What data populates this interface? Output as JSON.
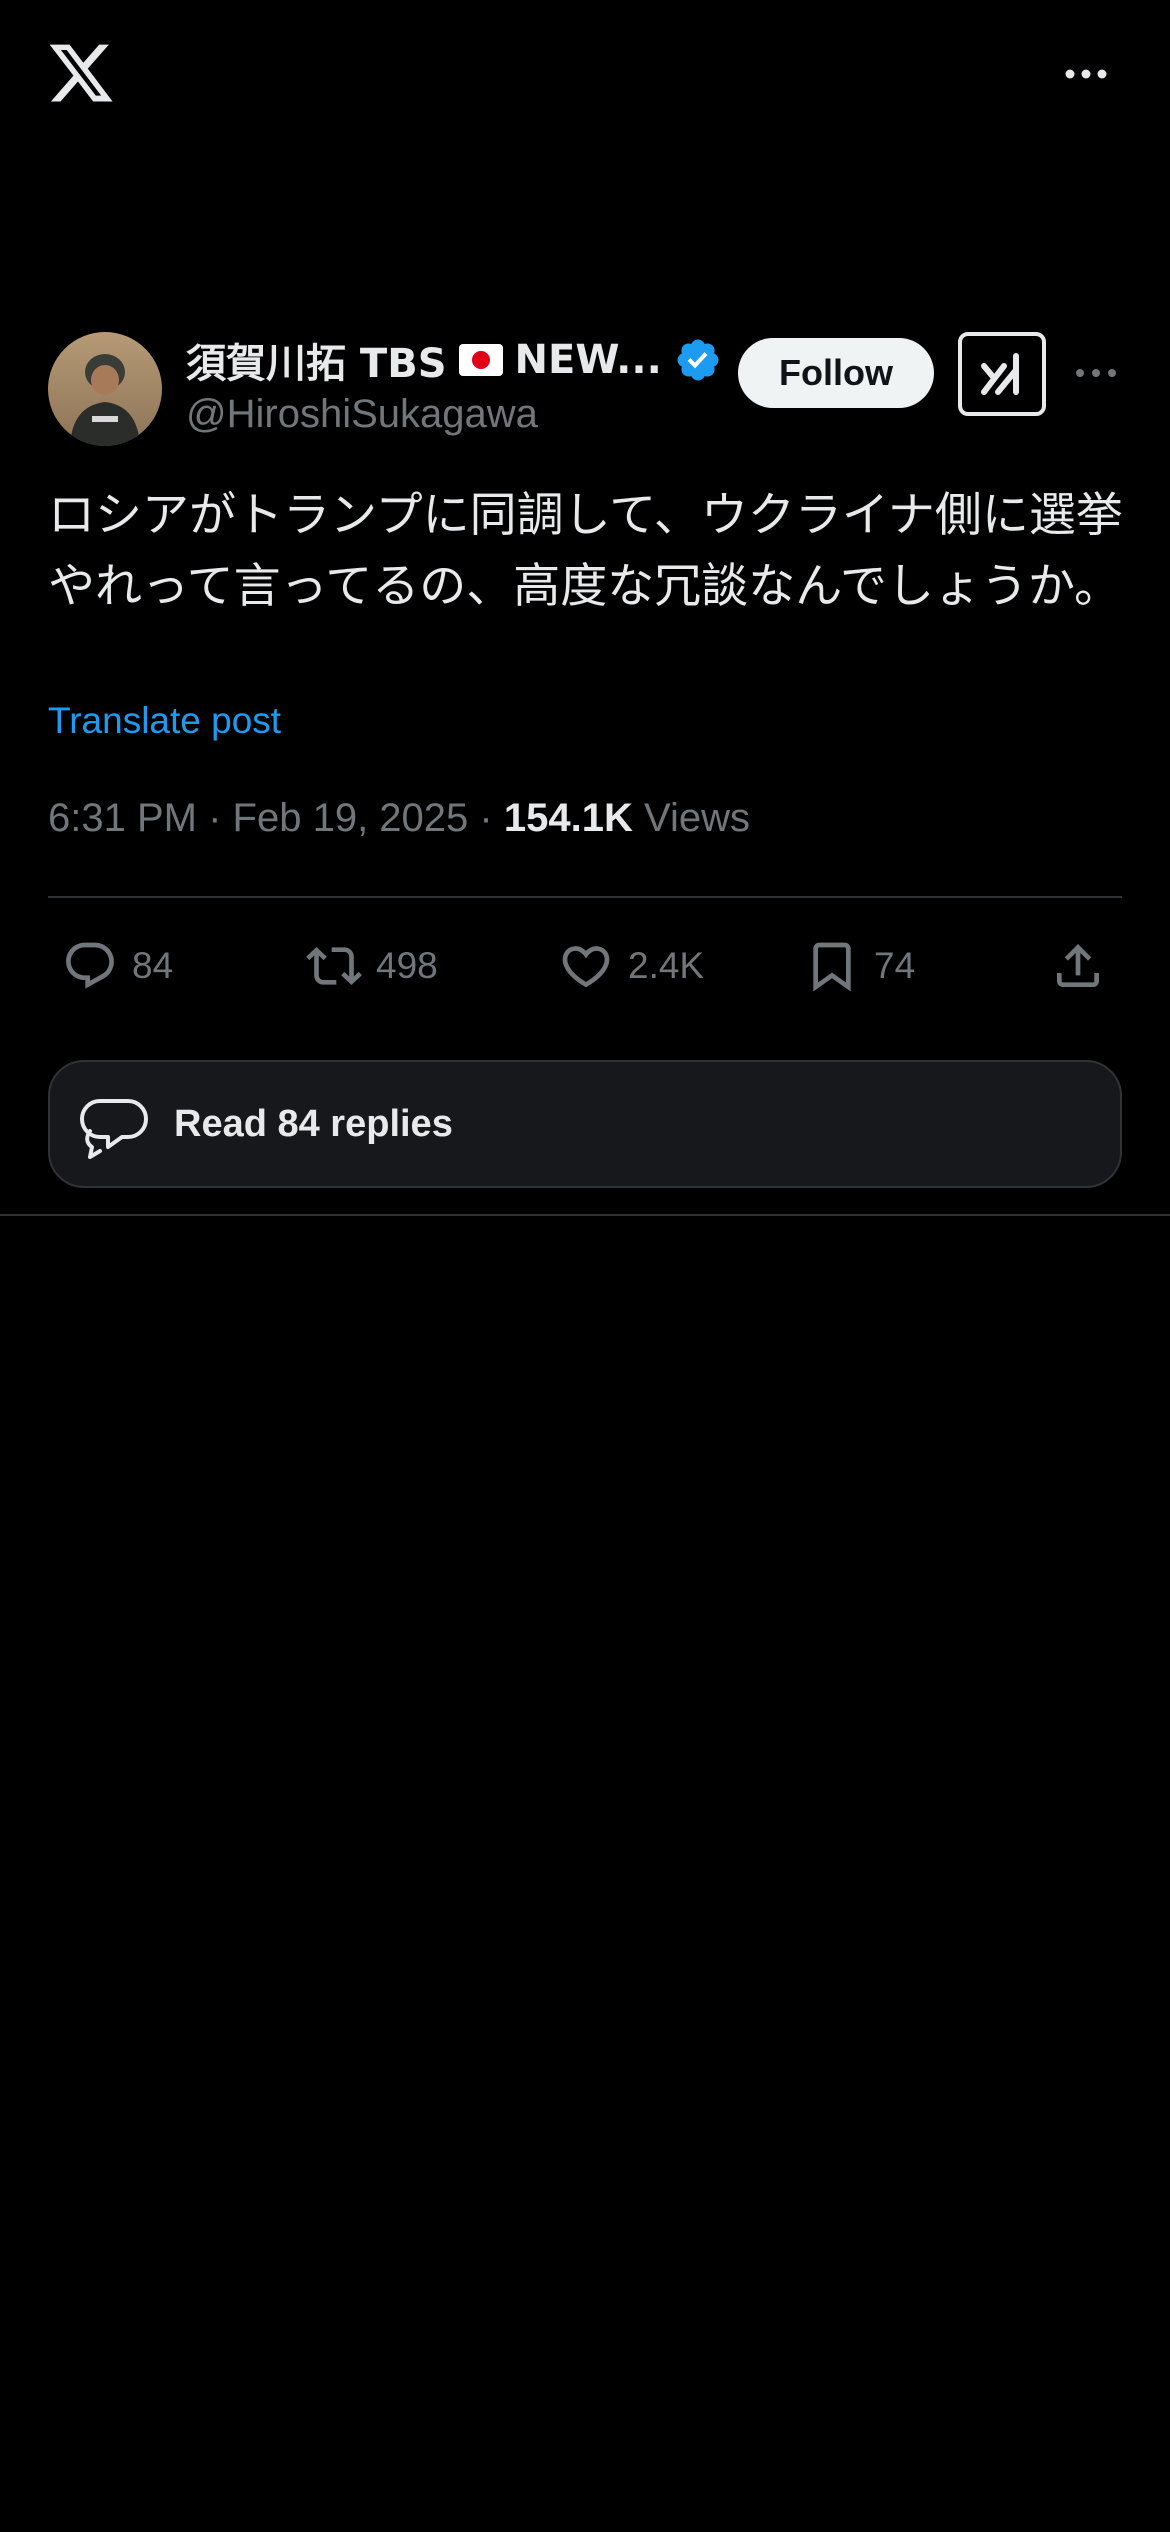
{
  "header": {
    "logo_icon": "x-logo-icon",
    "more_icon": "more-horizontal-icon"
  },
  "author": {
    "display_name": "須賀川拓 TBS",
    "flag_icon": "japan-flag-icon",
    "display_name_suffix": "NEW...",
    "verified_icon": "verified-badge-icon",
    "handle": "@HiroshiSukagawa",
    "follow_label": "Follow",
    "grok_icon": "grok-icon",
    "more_icon": "more-horizontal-icon"
  },
  "tweet": {
    "text": "ロシアがトランプに同調して、ウクライナ側に選挙やれって言ってるの、高度な冗談なんでしょうか。",
    "translate_label": "Translate post",
    "time": "6:31 PM",
    "date": "Feb 19, 2025",
    "separator": "·",
    "views_count": "154.1K",
    "views_label": "Views"
  },
  "actions": {
    "replies": "84",
    "reposts": "498",
    "likes": "2.4K",
    "bookmarks": "74"
  },
  "read_replies_label": "Read 84 replies",
  "colors": {
    "background": "#000000",
    "text_primary": "#e7e9ea",
    "text_secondary": "#71767b",
    "link": "#1d9bf0",
    "verified": "#1d9bf0",
    "divider": "#2f3336"
  }
}
